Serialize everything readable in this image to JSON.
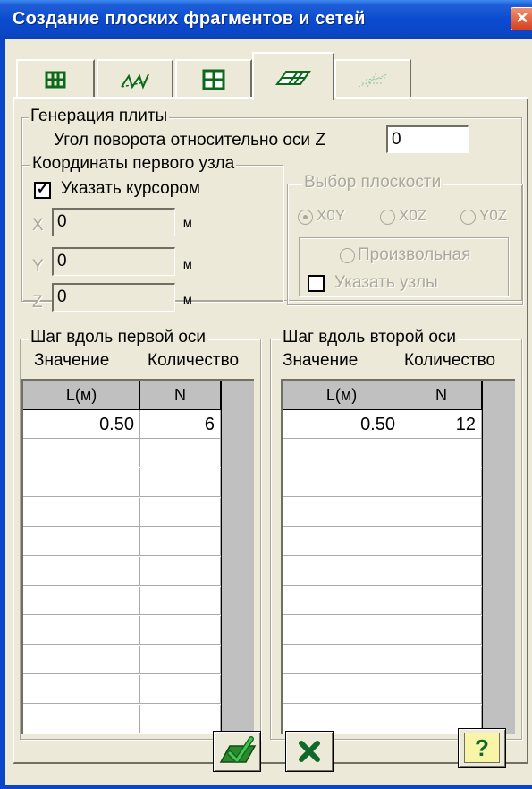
{
  "window": {
    "title": "Создание плоских фрагментов и сетей",
    "close_glyph": "✕"
  },
  "tabs": [
    {
      "icon": "frame-icon",
      "active": false
    },
    {
      "icon": "truss-icon",
      "active": false
    },
    {
      "icon": "grid-icon",
      "active": false
    },
    {
      "icon": "plate-icon",
      "active": true
    },
    {
      "icon": "mesh-icon",
      "active": false
    }
  ],
  "plate_generation": {
    "legend": "Генерация плиты",
    "rotation_label": "Угол поворота относительно оси Z",
    "rotation_value": "0"
  },
  "first_node": {
    "legend": "Координаты первого узла",
    "cursor_checkbox_label": "Указать курсором",
    "cursor_checked": true,
    "check_glyph": "✓",
    "fields": [
      {
        "axis": "X",
        "value": "0",
        "unit": "м"
      },
      {
        "axis": "Y",
        "value": "0",
        "unit": "м"
      },
      {
        "axis": "Z",
        "value": "0",
        "unit": "м"
      }
    ]
  },
  "plane_choice": {
    "legend": "Выбор плоскости",
    "options": [
      "X0Y",
      "X0Z",
      "Y0Z"
    ],
    "selected": "X0Y",
    "arbitrary_label": "Произвольная",
    "nodes_label": "Указать узлы"
  },
  "first_axis": {
    "legend": "Шаг вдоль первой оси",
    "col_value": "Значение",
    "col_count": "Количество",
    "headers": [
      "L(м)",
      "N"
    ],
    "rows": [
      [
        "0.50",
        "6"
      ]
    ]
  },
  "second_axis": {
    "legend": "Шаг вдоль второй оси",
    "col_value": "Значение",
    "col_count": "Количество",
    "headers": [
      "L(м)",
      "N"
    ],
    "rows": [
      [
        "0.50",
        "12"
      ]
    ]
  },
  "buttons": {
    "help_label": "?"
  },
  "colors": {
    "title_bar": "#0a4bd0",
    "dialog_bg": "#ece9d8",
    "ok_green": "#2b8a2b",
    "cancel_green": "#0f6a2a",
    "help_yellow": "#f8f4a8"
  }
}
